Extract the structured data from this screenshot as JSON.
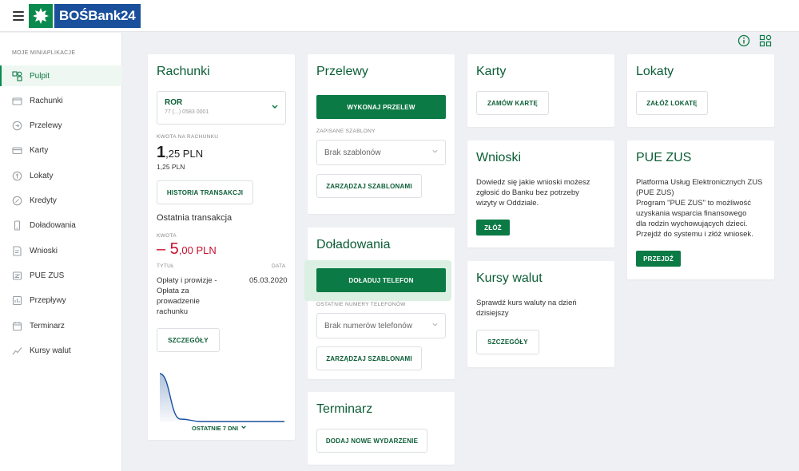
{
  "header": {
    "logo_text": "BOŚBank24"
  },
  "sidebar": {
    "section_label": "MOJE MINIAPLIKACJE",
    "items": [
      {
        "label": "Pulpit",
        "icon": "dashboard-icon",
        "active": true
      },
      {
        "label": "Rachunki",
        "icon": "wallet-icon"
      },
      {
        "label": "Przelewy",
        "icon": "transfer-icon"
      },
      {
        "label": "Karty",
        "icon": "card-icon"
      },
      {
        "label": "Lokaty",
        "icon": "deposit-icon"
      },
      {
        "label": "Kredyty",
        "icon": "loan-icon"
      },
      {
        "label": "Doładowania",
        "icon": "phone-icon"
      },
      {
        "label": "Wnioski",
        "icon": "form-icon"
      },
      {
        "label": "PUE ZUS",
        "icon": "zus-icon"
      },
      {
        "label": "Przepływy",
        "icon": "flows-icon"
      },
      {
        "label": "Terminarz",
        "icon": "calendar-icon"
      },
      {
        "label": "Kursy walut",
        "icon": "chart-line-icon"
      }
    ]
  },
  "rachunki": {
    "title": "Rachunki",
    "account_name": "ROR",
    "account_number": "77 (...) 0583 0001",
    "amount_label": "KWOTA NA RACHUNKU",
    "amount_int": "1",
    "amount_frac": ",25 PLN",
    "amount_small": "1,25 PLN",
    "history_button": "HISTORIA TRANSAKCJI",
    "last_tx_title": "Ostatnia transakcja",
    "kwota_label": "KWOTA",
    "tx_amount_int": "– 5",
    "tx_amount_frac": ",00 PLN",
    "tytul_label": "TYTUŁ",
    "data_label": "DATA",
    "tx_title_lines": [
      "Opłaty i prowizje -",
      "Opłata za",
      "prowadzenie",
      "rachunku"
    ],
    "tx_date": "05.03.2020",
    "details_button": "SZCZEGÓŁY",
    "period_label": "OSTATNIE 7 DNI"
  },
  "przelewy": {
    "title": "Przelewy",
    "primary_button": "WYKONAJ PRZELEW",
    "templates_label": "ZAPISANE SZABLONY",
    "templates_select": "Brak szablonów",
    "manage_button": "ZARZĄDZAJ SZABLONAMI"
  },
  "doladowania": {
    "title": "Doładowania",
    "primary_button": "DOŁADUJ TELEFON",
    "numbers_label": "OSTATNIE NUMERY TELEFONÓW",
    "numbers_select": "Brak numerów telefonów",
    "manage_button": "ZARZĄDZAJ SZABLONAMI"
  },
  "terminarz": {
    "title": "Terminarz",
    "button": "DODAJ NOWE WYDARZENIE"
  },
  "karty": {
    "title": "Karty",
    "button": "ZAMÓW KARTĘ"
  },
  "wnioski": {
    "title": "Wnioski",
    "text_lines": [
      "Dowiedz się jakie wnioski możesz",
      "zgłosić do Banku bez potrzeby",
      "wizyty w Oddziale."
    ],
    "button": "ZŁÓŻ"
  },
  "kursy": {
    "title": "Kursy walut",
    "text_lines": [
      "Sprawdź kurs waluty na dzień",
      "dzisiejszy"
    ],
    "button": "SZCZEGÓŁY"
  },
  "lokaty": {
    "title": "Lokaty",
    "button": "ZAŁÓŻ LOKATĘ"
  },
  "pue": {
    "title": "PUE ZUS",
    "text_lines": [
      "Platforma Usług Elektronicznych ZUS",
      "(PUE ZUS)",
      "Program \"PUE ZUS\" to możliwość",
      "uzyskania wsparcia finansowego",
      "dla rodzin wychowujących dzieci.",
      "Przejdź do systemu i złóż wniosek."
    ],
    "button": "PRZEJDŹ"
  },
  "colors": {
    "brand_green": "#0b7a44",
    "brand_blue": "#1a4f9c",
    "negative_red": "#c8102e"
  },
  "chart_data": {
    "type": "area",
    "x": [
      0,
      1,
      2,
      3,
      4,
      5,
      6
    ],
    "values": [
      1,
      0.05,
      0,
      0,
      0,
      0,
      0
    ]
  }
}
